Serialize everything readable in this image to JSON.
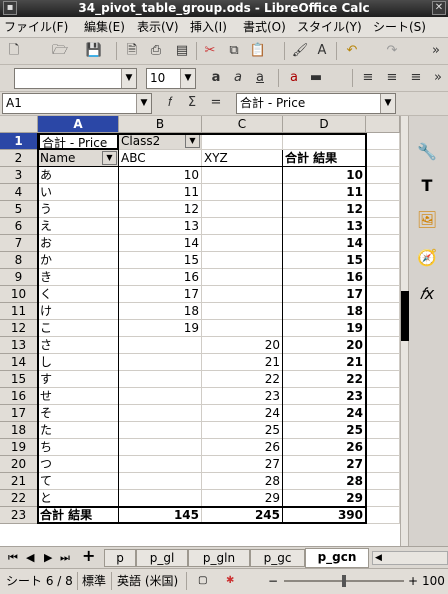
{
  "window": {
    "title": "34_pivot_table_group.ods - LibreOffice Calc"
  },
  "menu": [
    "ファイル(F)",
    "編集(E)",
    "表示(V)",
    "挿入(I)",
    "書式(O)",
    "スタイル(Y)",
    "シート(S)"
  ],
  "format_bar": {
    "font_name": "",
    "font_size": "10"
  },
  "formula_bar": {
    "name_box": "A1",
    "content": "合計 - Price"
  },
  "grid": {
    "columns": [
      "A",
      "B",
      "C",
      "D"
    ],
    "rows": [
      "1",
      "2",
      "3",
      "4",
      "5",
      "6",
      "7",
      "8",
      "9",
      "10",
      "11",
      "12",
      "13",
      "14",
      "15",
      "16",
      "17",
      "18",
      "19",
      "20",
      "21",
      "22",
      "23"
    ],
    "r1": {
      "a": "合計 - Price",
      "b": "Class2"
    },
    "r2": {
      "a": "Name",
      "b": "ABC",
      "c": "XYZ",
      "d": "合計 結果"
    },
    "names": [
      "あ",
      "い",
      "う",
      "え",
      "お",
      "か",
      "き",
      "く",
      "け",
      "こ",
      "さ",
      "し",
      "す",
      "せ",
      "そ",
      "た",
      "ち",
      "つ",
      "て",
      "と"
    ],
    "abc": [
      "10",
      "11",
      "12",
      "13",
      "14",
      "15",
      "16",
      "17",
      "18",
      "19"
    ],
    "xyz": [
      "20",
      "21",
      "22",
      "23",
      "24",
      "25",
      "26",
      "27",
      "28",
      "29"
    ],
    "total": [
      "10",
      "11",
      "12",
      "13",
      "14",
      "15",
      "16",
      "17",
      "18",
      "19",
      "20",
      "21",
      "22",
      "23",
      "24",
      "25",
      "26",
      "27",
      "28",
      "29"
    ],
    "r23": {
      "a": "合計 結果",
      "b": "145",
      "c": "245",
      "d": "390"
    }
  },
  "sheets": {
    "tabs": [
      "p",
      "p_gl",
      "p_gln",
      "p_gc",
      "p_gcn"
    ],
    "active": "p_gcn"
  },
  "status": {
    "sheet": "シート 6 / 8",
    "style": "標準",
    "language": "英語 (米国)",
    "zoom": "100"
  },
  "colors": {
    "selection": "#2b47a6"
  }
}
